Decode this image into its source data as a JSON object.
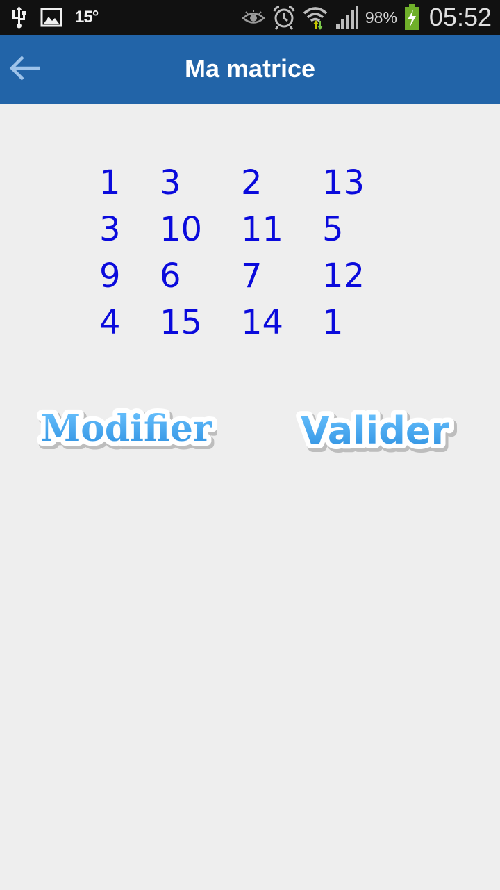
{
  "status_bar": {
    "temperature": "15°",
    "battery_percent": "98%",
    "time": "05:52",
    "icons": [
      "usb-icon",
      "image-icon",
      "eye-icon",
      "alarm-icon",
      "wifi-icon",
      "signal-icon",
      "battery-charging-icon"
    ]
  },
  "action_bar": {
    "title": "Ma matrice",
    "back_icon": "back-arrow-icon",
    "color": "#2264a8"
  },
  "matrix": {
    "rows": [
      [
        "1",
        "3",
        "2",
        "13"
      ],
      [
        "3",
        "10",
        "11",
        "5"
      ],
      [
        "9",
        "6",
        "7",
        "12"
      ],
      [
        "4",
        "15",
        "14",
        "1"
      ]
    ],
    "color": "#0a0adc"
  },
  "buttons": {
    "modify_label": "Modifier",
    "validate_label": "Valider",
    "color": "#3aa0e8"
  }
}
